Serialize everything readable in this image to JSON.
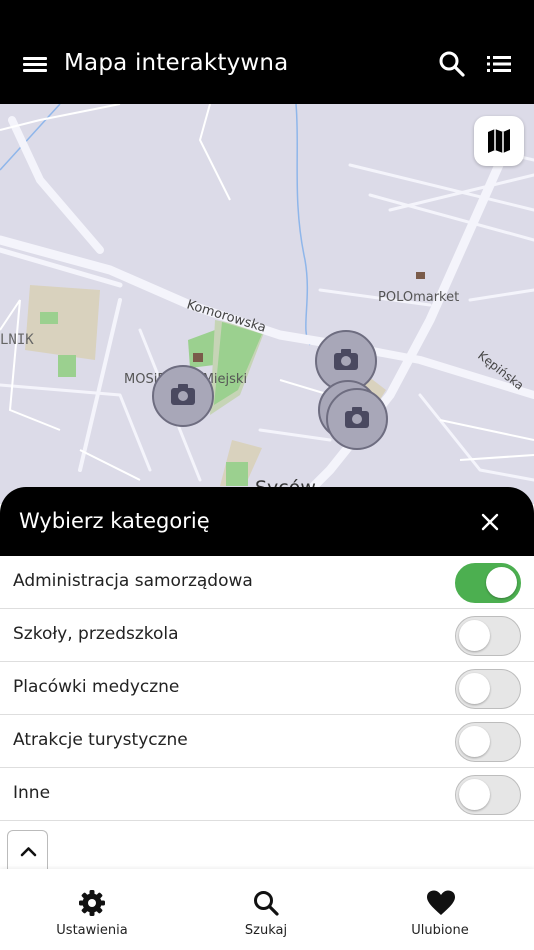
{
  "appbar": {
    "title": "Mapa interaktywna",
    "icons": [
      "menu-icon",
      "search-icon",
      "list-icon"
    ]
  },
  "map": {
    "streets": [
      "Komorowska",
      "Kępińska"
    ],
    "places": [
      "POLOmarket",
      "MOSiR",
      "Park Miejski",
      "Syców",
      "LNIK"
    ],
    "markers": [
      "camera-icon",
      "camera-icon",
      "camera-icon",
      "camera-icon"
    ],
    "layers_icon": "map-icon"
  },
  "sheet": {
    "title": "Wybierz kategorię",
    "close_icon": "close-icon",
    "categories": [
      {
        "label": "Administracja samorządowa",
        "enabled": true
      },
      {
        "label": "Szkoły, przedszkola",
        "enabled": false
      },
      {
        "label": "Placówki medyczne",
        "enabled": false
      },
      {
        "label": "Atrakcje turystyczne",
        "enabled": false
      },
      {
        "label": "Inne",
        "enabled": false
      }
    ]
  },
  "bottom_nav": {
    "items": [
      {
        "label": "Ustawienia",
        "icon": "gear-icon"
      },
      {
        "label": "Szukaj",
        "icon": "search-icon"
      },
      {
        "label": "Ulubione",
        "icon": "heart-icon"
      }
    ]
  },
  "colors": {
    "appbar": "#000000",
    "toggle_on": "#4caf50",
    "map_bg": "#dcdbe8",
    "road": "#f4f4fb",
    "green_area": "#9bd08f",
    "marker": "#a8a7b8"
  }
}
